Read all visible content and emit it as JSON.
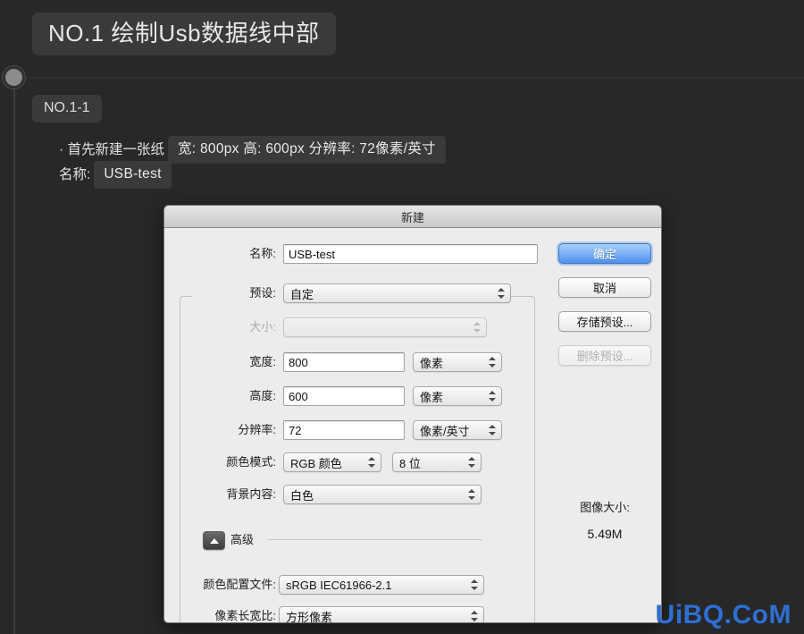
{
  "tutorial": {
    "step_title": "NO.1 绘制Usb数据线中部",
    "substep_tag": "NO.1-1",
    "note_prefix": "· 首先新建一张纸",
    "note_specs": "宽: 800px 高: 600px 分辨率: 72像素/英寸",
    "note_name_label": "名称:",
    "note_name_value": "USB-test",
    "watermark": "UiBQ.CoM",
    "colors": {
      "background": "#282828",
      "chip": "#3a3a3a",
      "watermark": "#2f6fd0"
    }
  },
  "dialog": {
    "title": "新建",
    "name_label": "名称:",
    "name_value": "USB-test",
    "preset_label": "预设:",
    "preset_value": "自定",
    "size_label": "大小:",
    "size_value": "",
    "width_label": "宽度:",
    "width_value": "800",
    "width_unit": "像素",
    "height_label": "高度:",
    "height_value": "600",
    "height_unit": "像素",
    "resolution_label": "分辨率:",
    "resolution_value": "72",
    "resolution_unit": "像素/英寸",
    "color_mode_label": "颜色模式:",
    "color_mode_value": "RGB 颜色",
    "bit_depth_value": "8 位",
    "background_contents_label": "背景内容:",
    "background_contents_value": "白色",
    "advanced_label": "高级",
    "color_profile_label": "颜色配置文件:",
    "color_profile_value": "sRGB IEC61966-2.1",
    "pixel_aspect_label": "像素长宽比:",
    "pixel_aspect_value": "方形像素",
    "buttons": {
      "ok": "确定",
      "cancel": "取消",
      "save_preset": "存储预设...",
      "delete_preset": "删除预设..."
    },
    "image_size_label": "图像大小:",
    "image_size_value": "5.49M"
  }
}
